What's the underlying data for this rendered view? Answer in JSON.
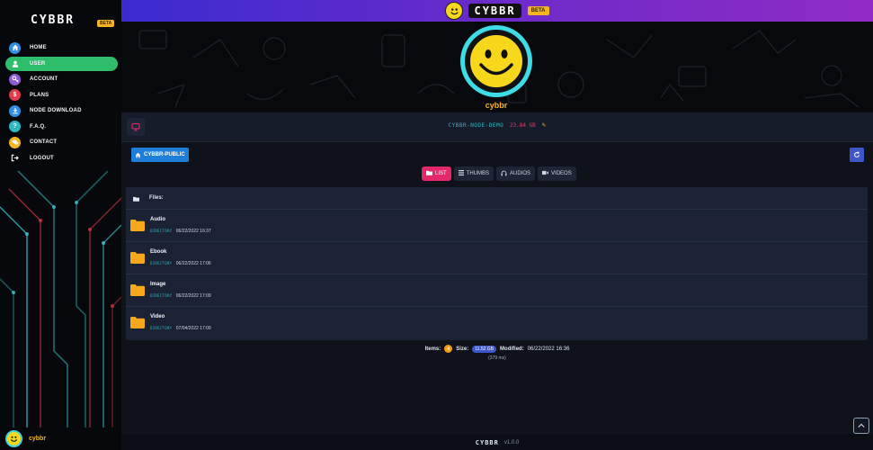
{
  "brand": {
    "name": "CYBBR",
    "beta": "BETA"
  },
  "sidebar": {
    "items": [
      {
        "label": "HOME",
        "icon": "home-icon",
        "color": "#2f8de4",
        "active": false
      },
      {
        "label": "USER",
        "icon": "user-icon",
        "color": "#2ebd6a",
        "active": true
      },
      {
        "label": "ACCOUNT",
        "icon": "key-icon",
        "color": "#8e5bd6",
        "active": false
      },
      {
        "label": "PLANS",
        "icon": "dollar-icon",
        "color": "#e23b4a",
        "active": false
      },
      {
        "label": "NODE DOWNLOAD",
        "icon": "download-icon",
        "color": "#2f8de4",
        "active": false
      },
      {
        "label": "F.A.Q.",
        "icon": "question-icon",
        "color": "#2fb7c6",
        "active": false
      },
      {
        "label": "CONTACT",
        "icon": "chat-icon",
        "color": "#f6b51e",
        "active": false
      },
      {
        "label": "LOGOUT",
        "icon": "logout-icon",
        "color": "#07080c",
        "active": false
      }
    ],
    "user": {
      "name": "cybbr"
    }
  },
  "topbar": {
    "logo": "CYBBR",
    "beta": "BETA"
  },
  "hero": {
    "username": "cybbr"
  },
  "node": {
    "name": "CYBBR-NODE-DEMO",
    "size": "23.84 GB",
    "edit_icon": "pencil-icon"
  },
  "bucket": {
    "label": "CYBBR-PUBLIC"
  },
  "views": [
    {
      "label": "LIST",
      "icon": "folder-icon",
      "active": true
    },
    {
      "label": "THUMBS",
      "icon": "grid-icon",
      "active": false
    },
    {
      "label": "AUDIOS",
      "icon": "headphones-icon",
      "active": false
    },
    {
      "label": "VIDEOS",
      "icon": "video-icon",
      "active": false
    }
  ],
  "files": {
    "header": "Files:",
    "rows": [
      {
        "name": "Audio",
        "type": "DIRECTORY",
        "date": "06/22/2022 16:37"
      },
      {
        "name": "Ebook",
        "type": "DIRECTORY",
        "date": "06/22/2022 17:06"
      },
      {
        "name": "Image",
        "type": "DIRECTORY",
        "date": "06/22/2022 17:09"
      },
      {
        "name": "Video",
        "type": "DIRECTORY",
        "date": "07/04/2022 17:09"
      }
    ]
  },
  "summary": {
    "items_label": "Items:",
    "items_count": "4",
    "size_label": "Size:",
    "size_value": "11.52 GB",
    "modified_label": "Modified:",
    "modified_value": "06/22/2022 16:36",
    "timing": "(379 ms)"
  },
  "footer": {
    "logo": "CYBBR",
    "version": "v1.0.0"
  },
  "colors": {
    "accent_pink": "#e5286a",
    "accent_blue": "#3d57c9",
    "folder": "#f6a71c",
    "cyan": "#2fb7c6"
  }
}
